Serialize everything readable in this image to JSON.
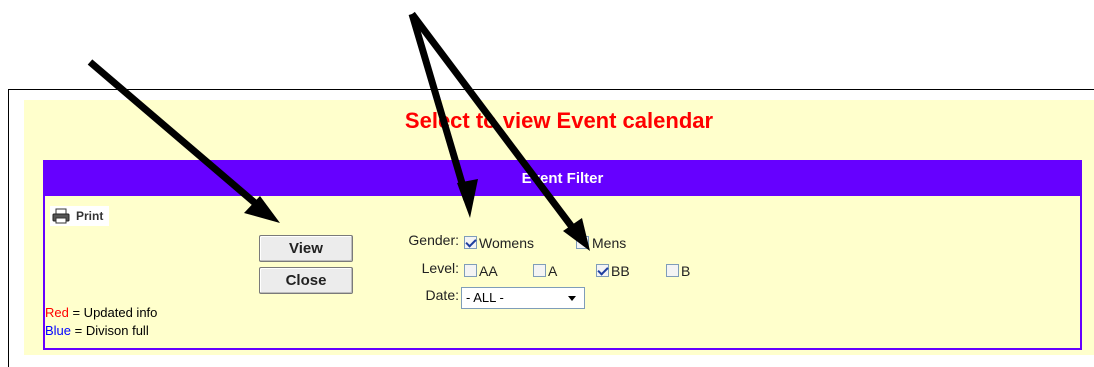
{
  "page_title": "Select to view Event calendar",
  "filter": {
    "header": "Event Filter",
    "print_label": "Print",
    "view_label": "View",
    "close_label": "Close"
  },
  "legend": {
    "red_word": "Red",
    "red_text": " = Updated info",
    "blue_word": "Blue",
    "blue_text": " = Divison full"
  },
  "form": {
    "gender_label": "Gender:",
    "gender_options": [
      {
        "label": "Womens",
        "checked": true
      },
      {
        "label": "Mens",
        "checked": false
      }
    ],
    "level_label": "Level:",
    "level_options": [
      {
        "label": "AA",
        "checked": false
      },
      {
        "label": "A",
        "checked": false
      },
      {
        "label": "BB",
        "checked": true
      },
      {
        "label": "B",
        "checked": false
      }
    ],
    "date_label": "Date:",
    "date_value": "- ALL -"
  },
  "colors": {
    "title": "#ff0000",
    "header_bg": "#6600ff",
    "panel_bg": "#ffffcc"
  }
}
